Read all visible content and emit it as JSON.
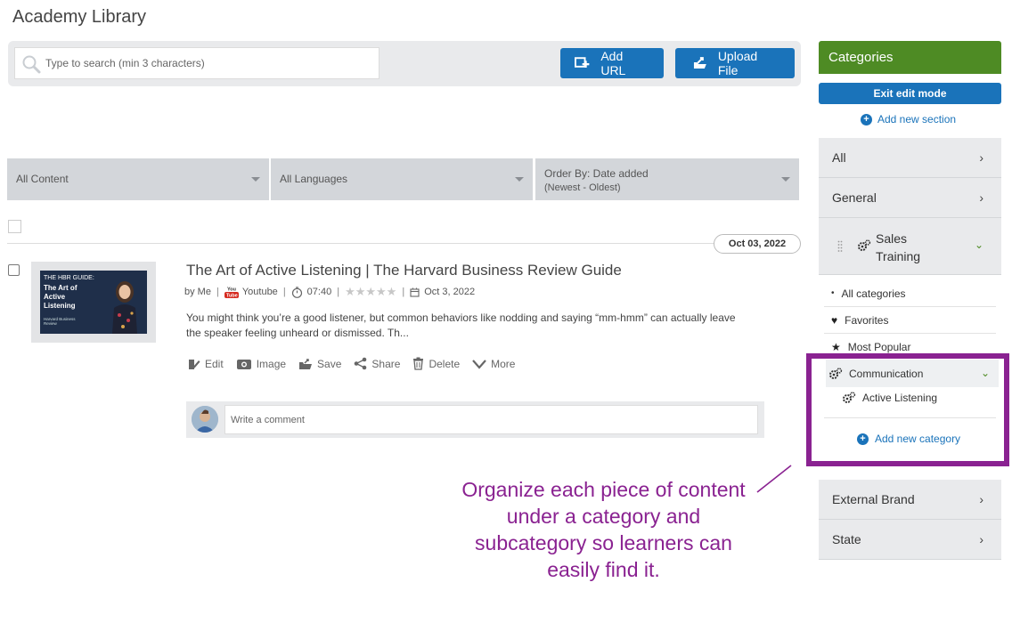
{
  "page": {
    "title": "Academy Library"
  },
  "search": {
    "placeholder": "Type to search (min 3 characters)"
  },
  "toolbar": {
    "add_url_label": "Add URL",
    "upload_label": "Upload File"
  },
  "filters": {
    "content": "All Content",
    "languages": "All Languages",
    "order_label": "Order By: Date added",
    "order_sub": "(Newest - Oldest)"
  },
  "date_group": "Oct 03, 2022",
  "item": {
    "title": "The Art of Active Listening | The Harvard Business Review Guide",
    "by": "by Me",
    "source": "Youtube",
    "duration": "07:40",
    "rating_stars": 0,
    "date": "Oct 3, 2022",
    "description": "You might think you’re a good listener, but common behaviors like nodding and saying “mm-hmm” can actually leave the speaker feeling unheard or dismissed. Th...",
    "thumbnail": {
      "small_text": "THE HBR GUIDE:",
      "big_text": "The Art of Active Listening",
      "publisher": "Harvard Business Review"
    },
    "actions": {
      "edit": "Edit",
      "image": "Image",
      "save": "Save",
      "share": "Share",
      "delete": "Delete",
      "more": "More"
    },
    "comment_placeholder": "Write a comment"
  },
  "categories": {
    "header": "Categories",
    "exit_edit": "Exit edit mode",
    "add_section": "Add new section",
    "all": "All",
    "general": "General",
    "sales_training": "Sales Training",
    "sub": {
      "all_categories": "All categories",
      "favorites": "Favorites",
      "most_popular": "Most Popular",
      "communication": "Communication",
      "active_listening": "Active Listening",
      "add_category": "Add new category"
    },
    "external_brand": "External Brand",
    "state": "State"
  },
  "callout": {
    "text": "Organize each piece of content under a category and subcategory so learners can easily find it."
  },
  "colors": {
    "accent_blue": "#1a73ba",
    "category_green": "#4e8b24",
    "highlight_purple": "#8a2291"
  }
}
